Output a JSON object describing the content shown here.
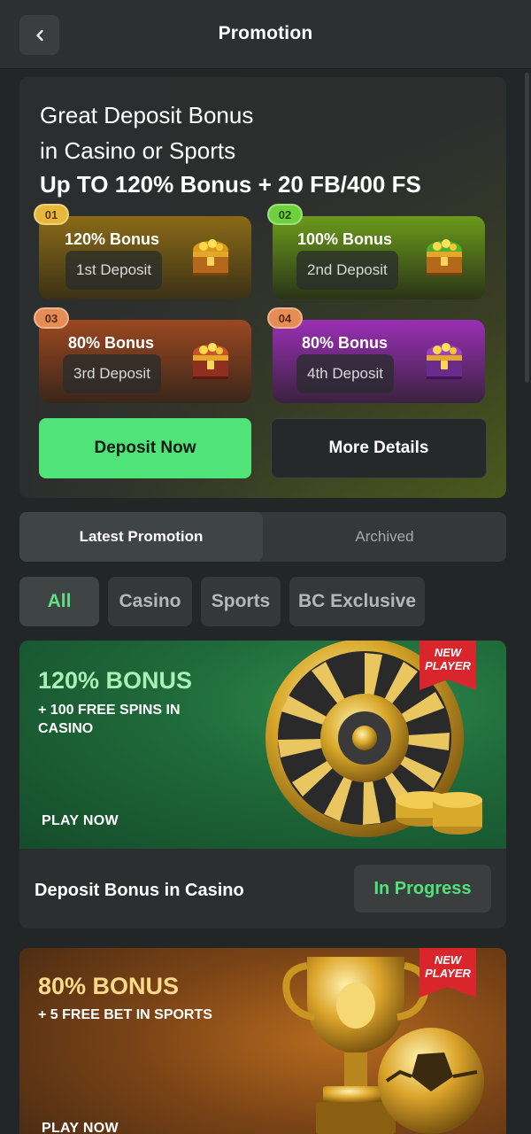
{
  "header": {
    "title": "Promotion",
    "back_icon": "chevron-left-icon"
  },
  "hero": {
    "line1": "Great Deposit Bonus",
    "line2": "in Casino or Sports",
    "line3": "Up TO 120% Bonus + 20 FB/400 FS",
    "tiles": [
      {
        "badge": "01",
        "title": "120% Bonus",
        "deposit": "1st Deposit",
        "color": "#e8b83b"
      },
      {
        "badge": "02",
        "title": "100% Bonus",
        "deposit": "2nd Deposit",
        "color": "#6fd03d"
      },
      {
        "badge": "03",
        "title": "80% Bonus",
        "deposit": "3rd Deposit",
        "color": "#e48d55"
      },
      {
        "badge": "04",
        "title": "80% Bonus",
        "deposit": "4th Deposit",
        "color": "#e48d55"
      }
    ],
    "deposit_button": "Deposit Now",
    "details_button": "More Details"
  },
  "tabs": [
    {
      "label": "Latest Promotion",
      "active": true
    },
    {
      "label": "Archived",
      "active": false
    }
  ],
  "filters": [
    {
      "label": "All",
      "active": true
    },
    {
      "label": "Casino",
      "active": false
    },
    {
      "label": "Sports",
      "active": false
    },
    {
      "label": "BC Exclusive",
      "active": false
    }
  ],
  "promos": [
    {
      "badge": "NEW PLAYER",
      "title": "120% BONUS",
      "subtitle": "+ 100 FREE SPINS IN CASINO",
      "cta": "PLAY NOW",
      "name": "Deposit Bonus in Casino",
      "status": "In Progress"
    },
    {
      "badge": "NEW PLAYER",
      "title": "80% BONUS",
      "subtitle": "+ 5 FREE BET IN SPORTS",
      "cta": "PLAY NOW"
    }
  ],
  "colors": {
    "accent_green": "#4fe37a",
    "background": "#232626",
    "card": "#2c2f2f"
  }
}
